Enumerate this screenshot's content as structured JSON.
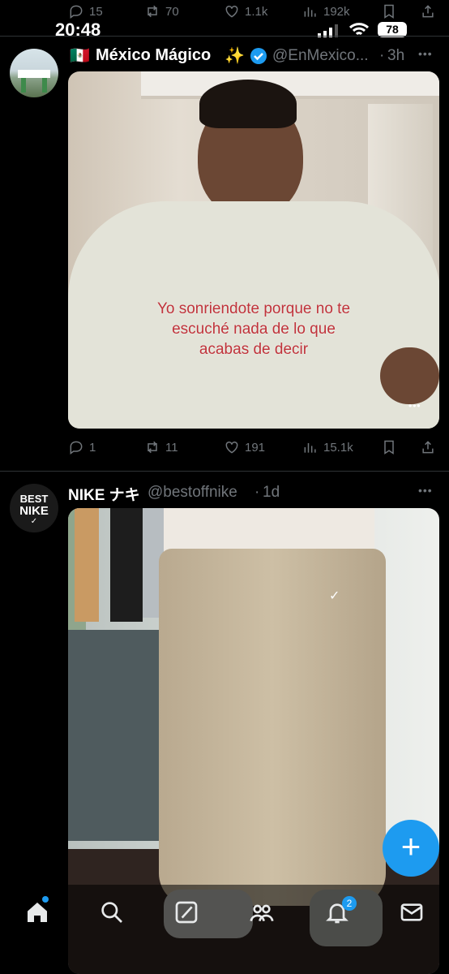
{
  "status_bar": {
    "time": "20:48",
    "battery": "78"
  },
  "prev_tweet_actions": {
    "replies": "15",
    "retweets": "70",
    "likes": "1.1k",
    "views": "192k"
  },
  "tweet1": {
    "flag": "🇲🇽",
    "name": "México Mágico",
    "sparkle": "✨",
    "handle": "@EnMexico...",
    "time": "3h",
    "caption_lines": [
      "Yo sonriendote porque no te",
      "escuché nada de lo que",
      "acabas de decir"
    ],
    "actions": {
      "replies": "1",
      "retweets": "11",
      "likes": "191",
      "views": "15.1k"
    }
  },
  "tweet2": {
    "name": "NIKE ナキ",
    "handle": "@bestoffnike",
    "time": "1d",
    "avatar_text": [
      "BEST",
      "NIKE"
    ]
  },
  "more_label": "•••",
  "fab_label": "+",
  "nav": {
    "notifications_badge": "2"
  },
  "colors": {
    "accent": "#1d9bf0",
    "caption": "#c0333b",
    "background": "#000000"
  }
}
